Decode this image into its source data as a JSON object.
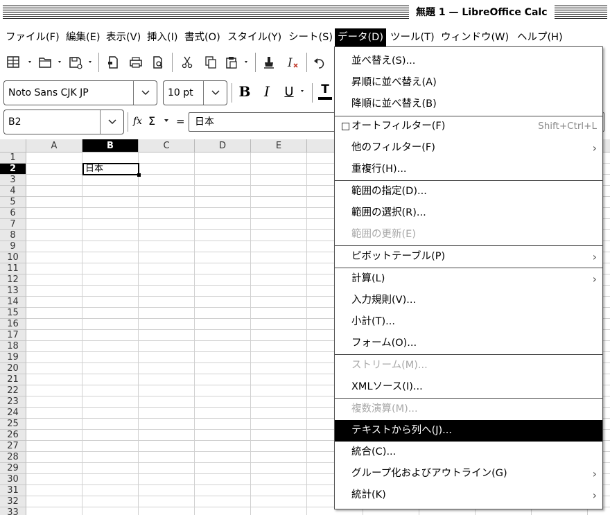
{
  "window": {
    "title": "無題 1 — LibreOffice Calc"
  },
  "menubar": {
    "items": [
      {
        "label": "ファイル(F)",
        "active": false
      },
      {
        "label": "編集(E)",
        "active": false
      },
      {
        "label": "表示(V)",
        "active": false
      },
      {
        "label": "挿入(I)",
        "active": false
      },
      {
        "label": "書式(O)",
        "active": false
      },
      {
        "label": "スタイル(Y)",
        "active": false
      },
      {
        "label": "シート(S)",
        "active": false
      },
      {
        "label": "データ(D)",
        "active": true
      },
      {
        "label": "ツール(T)",
        "active": false
      },
      {
        "label": "ウィンドウ(W)",
        "active": false
      },
      {
        "label": "ヘルプ(H)",
        "active": false
      }
    ]
  },
  "toolbar": {
    "icons": [
      "table-grid-icon",
      "open-folder-icon",
      "save-icon",
      "export-pdf-icon",
      "print-icon",
      "print-preview-icon",
      "cut-icon",
      "copy-icon",
      "paste-icon",
      "clone-formatting-icon",
      "clear-formatting-icon",
      "undo-icon"
    ]
  },
  "format_toolbar": {
    "font_name": "Noto Sans CJK JP",
    "font_size": "10 pt",
    "bold_label": "B",
    "italic_label": "I",
    "underline_label": "U",
    "font_color_label": "T"
  },
  "formula_bar": {
    "name_box": "B2",
    "function_wizard": "fx",
    "sum_symbol": "Σ",
    "equals_symbol": "=",
    "content": "日本"
  },
  "sheet": {
    "columns": [
      "A",
      "B",
      "C",
      "D",
      "E"
    ],
    "selected_column": "B",
    "rows": [
      "1",
      "2",
      "3",
      "4",
      "5",
      "6",
      "7",
      "8",
      "9",
      "10",
      "11",
      "12",
      "13",
      "14",
      "15",
      "16",
      "17",
      "18",
      "19",
      "20",
      "21",
      "22",
      "23",
      "24",
      "25",
      "26",
      "27",
      "28",
      "29",
      "30",
      "31",
      "32",
      "33"
    ],
    "selected_row": "2",
    "active_cell": {
      "ref": "B2",
      "value": "日本"
    }
  },
  "data_menu": {
    "items": [
      {
        "label": "並べ替え(S)...",
        "disabled": false
      },
      {
        "label": "昇順に並べ替え(A)",
        "disabled": false
      },
      {
        "label": "降順に並べ替え(B)",
        "disabled": false
      },
      {
        "label": "オートフィルター(F)",
        "shortcut": "Shift+Ctrl+L",
        "checkbox": true,
        "disabled": false
      },
      {
        "label": "他のフィルター(F)",
        "submenu": true,
        "disabled": false
      },
      {
        "label": "重複行(H)...",
        "disabled": false
      },
      {
        "label": "範囲の指定(D)...",
        "disabled": false
      },
      {
        "label": "範囲の選択(R)...",
        "disabled": false
      },
      {
        "label": "範囲の更新(E)",
        "disabled": true
      },
      {
        "label": "ピボットテーブル(P)",
        "submenu": true,
        "disabled": false
      },
      {
        "label": "計算(L)",
        "submenu": true,
        "disabled": false
      },
      {
        "label": "入力規則(V)...",
        "disabled": false
      },
      {
        "label": "小計(T)...",
        "disabled": false
      },
      {
        "label": "フォーム(O)...",
        "disabled": false
      },
      {
        "label": "ストリーム(M)...",
        "disabled": true
      },
      {
        "label": "XMLソース(I)...",
        "disabled": false
      },
      {
        "label": "複数演算(M)...",
        "disabled": true
      },
      {
        "label": "テキストから列へ(J)...",
        "highlighted": true,
        "disabled": false
      },
      {
        "label": "統合(C)...",
        "disabled": false
      },
      {
        "label": "グループ化およびアウトライン(G)",
        "submenu": true,
        "disabled": false
      },
      {
        "label": "統計(K)",
        "submenu": true,
        "disabled": false
      }
    ],
    "submenu_arrow": "›"
  }
}
